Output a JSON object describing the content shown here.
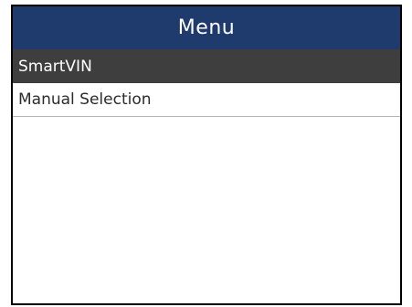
{
  "header": {
    "title": "Menu"
  },
  "menu": {
    "items": [
      {
        "label": "SmartVIN",
        "selected": true
      },
      {
        "label": "Manual Selection",
        "selected": false
      }
    ]
  },
  "colors": {
    "header_bg": "#1f3b6d",
    "selected_bg": "#3e3e3e",
    "text_white": "#ffffff",
    "text_dark": "#2b2b2b"
  }
}
